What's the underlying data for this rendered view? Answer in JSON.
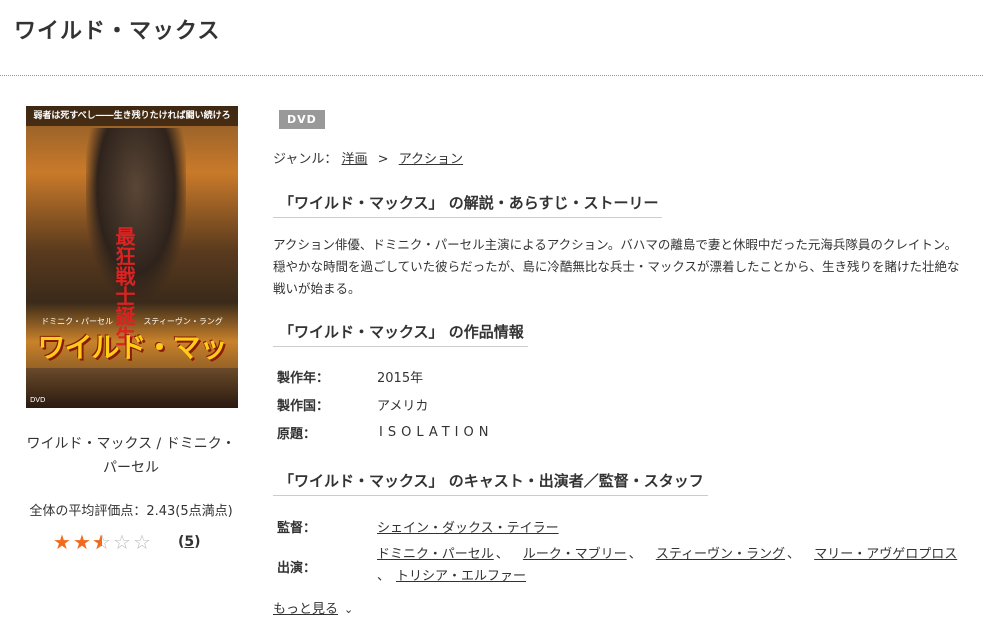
{
  "page": {
    "title": "ワイルド・マックス"
  },
  "poster": {
    "tagline_top": "弱者は死すべし――生き残りたければ闘い続けろ",
    "tagline_red": "最狂戦士誕生",
    "cast_left": "ドミニク・パーセル",
    "cast_right": "スティーヴン・ラング",
    "logo": "ワイルド・マックス",
    "dvd_mark": "DVD"
  },
  "caption": {
    "line1": "ワイルド・マックス / ドミニク・",
    "line2": "パーセル"
  },
  "rating": {
    "avg_text": "全体の平均評価点：2.43(5点満点)",
    "value": 2.43,
    "max": 5,
    "count_open": "(",
    "count": "5",
    "count_close": ")"
  },
  "badge": "DVD",
  "genre": {
    "label": "ジャンル：",
    "items": [
      "洋画",
      "アクション"
    ],
    "sep": ">"
  },
  "sections": {
    "story_head": "「ワイルド・マックス」 の解説・あらすじ・ストーリー",
    "info_head": "「ワイルド・マックス」 の作品情報",
    "cast_head": "「ワイルド・マックス」 のキャスト・出演者／監督・スタッフ"
  },
  "synopsis": "アクション俳優、ドミニク・パーセル主演によるアクション。バハマの離島で妻と休暇中だった元海兵隊員のクレイトン。穏やかな時間を過ごしていた彼らだったが、島に冷酷無比な兵士・マックスが漂着したことから、生き残りを賭けた壮絶な戦いが始まる。",
  "info": {
    "year_key": "製作年：",
    "year_val": "2015年",
    "country_key": "製作国：",
    "country_val": "アメリカ",
    "original_key": "原題：",
    "original_val": "ISOLATION"
  },
  "staff": {
    "director_key": "監督：",
    "director": "シェイン・ダックス・テイラー",
    "cast_key": "出演：",
    "cast": [
      "ドミニク・パーセル",
      "ルーク・マブリー",
      "スティーヴン・ラング",
      "マリー・アヴゲロプロス",
      "トリシア・エルファー"
    ],
    "sep": "、"
  },
  "more": {
    "label": "もっと見る"
  },
  "colors": {
    "star": "#f26a1b",
    "badge": "#999999"
  }
}
